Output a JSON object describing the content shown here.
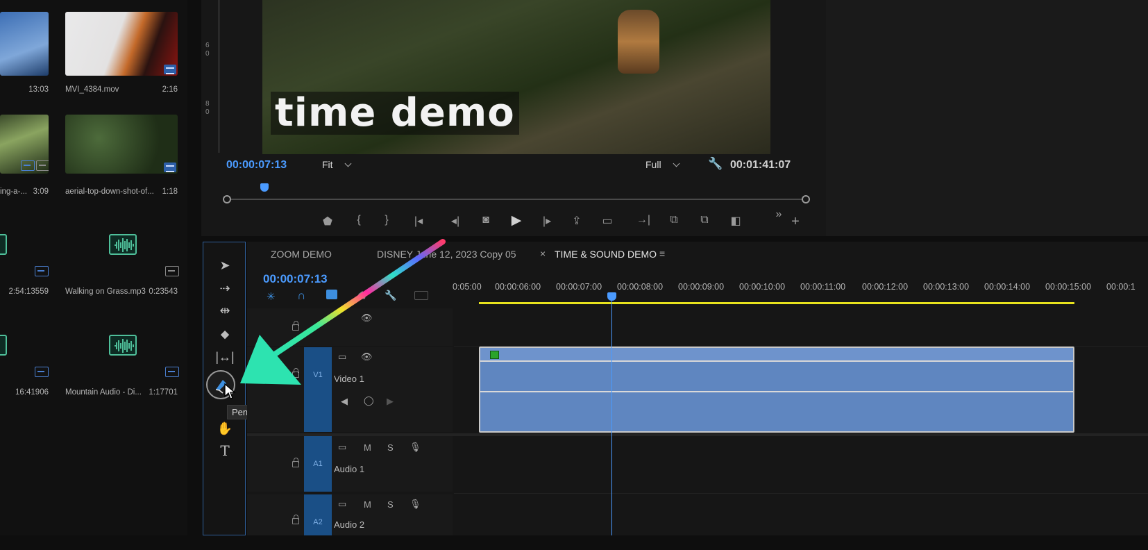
{
  "project": {
    "items": [
      {
        "name": "",
        "duration": "13:03"
      },
      {
        "name": "MVI_4384.mov",
        "duration": "2:16"
      },
      {
        "name": "ing-a-...",
        "duration": "3:09"
      },
      {
        "name": "aerial-top-down-shot-of...",
        "duration": "1:18"
      },
      {
        "name": "",
        "duration": "2:54:13559"
      },
      {
        "name": "Walking on Grass.mp3",
        "duration": "0:23543"
      },
      {
        "name": "",
        "duration": "16:41906"
      },
      {
        "name": "Mountain Audio - Di...",
        "duration": "1:17701"
      }
    ]
  },
  "monitor": {
    "ruler_marks": [
      "6",
      "0",
      "8",
      "0"
    ],
    "overlay_text": "time demo",
    "current_timecode": "00:00:07:13",
    "fit_option": "Fit",
    "quality_option": "Full",
    "duration_timecode": "00:01:41:07"
  },
  "timeline": {
    "tabs": [
      {
        "label": "ZOOM DEMO"
      },
      {
        "label": "DISNEY June 12, 2023 Copy 05"
      },
      {
        "label": "TIME & SOUND DEMO"
      }
    ],
    "close_symbol": "×",
    "menu_symbol": "≡",
    "timecode": "00:00:07:13",
    "ruler": [
      "0:05:00",
      "00:00:06:00",
      "00:00:07:00",
      "00:00:08:00",
      "00:00:09:00",
      "00:00:10:00",
      "00:00:11:00",
      "00:00:12:00",
      "00:00:13:00",
      "00:00:14:00",
      "00:00:15:00",
      "00:00:1"
    ],
    "tracks": [
      {
        "id": "V1",
        "name": "Video 1"
      },
      {
        "id": "A1",
        "name": "Audio 1"
      },
      {
        "id": "A2",
        "name": "Audio 2"
      }
    ],
    "track_letters": {
      "mute": "M",
      "solo": "S"
    },
    "tooltip": "Pen Tool (P)"
  },
  "colors": {
    "accent_blue": "#4b9bff",
    "clip_blue": "#5f86c0",
    "work_area_yellow": "#e7e21d",
    "audio_green": "#4fbf9a"
  }
}
